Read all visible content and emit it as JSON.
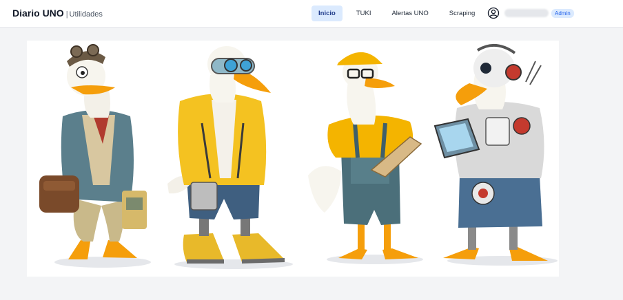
{
  "header": {
    "brand_name": "Diario UNO",
    "brand_separator": "|",
    "brand_sub": "Utilidades"
  },
  "nav": {
    "items": [
      {
        "label": "Inicio",
        "active": true
      },
      {
        "label": "TUKI",
        "active": false
      },
      {
        "label": "Alertas UNO",
        "active": false
      },
      {
        "label": "Scraping",
        "active": false
      }
    ]
  },
  "user": {
    "icon": "user-circle-icon",
    "role_badge": "Admin"
  },
  "hero": {
    "image": "four-duck-characters-illustration",
    "characters": [
      "explorer-duck",
      "cyberpunk-duck",
      "worker-duck",
      "robot-duck"
    ]
  },
  "colors": {
    "accent_bg": "#dbeafe",
    "accent_text": "#1e3a8a",
    "badge_text": "#2563eb",
    "page_bg": "#f3f4f6"
  }
}
